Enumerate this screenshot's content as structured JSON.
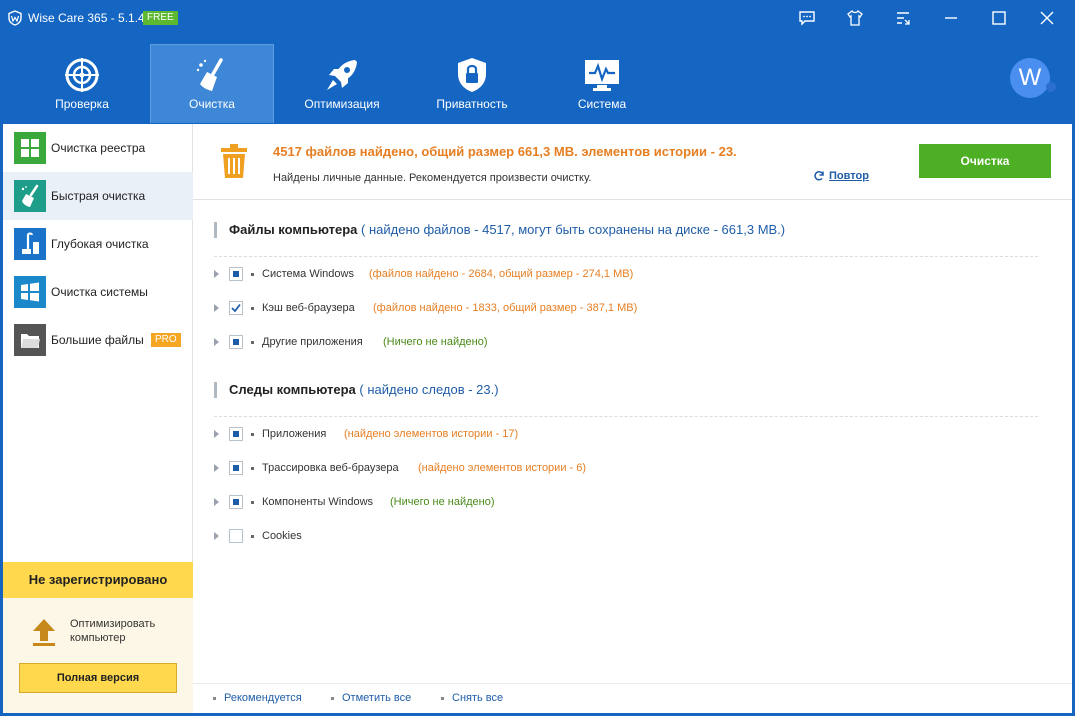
{
  "app": {
    "title": "Wise Care 365 - 5.1.4",
    "badge": "FREE",
    "avatar_letter": "W"
  },
  "window_controls": [
    "feedback-icon",
    "skin-icon",
    "menu-icon",
    "minimize-icon",
    "maximize-icon",
    "close-icon"
  ],
  "nav": {
    "items": [
      {
        "label": "Проверка",
        "icon": "radar-icon"
      },
      {
        "label": "Очистка",
        "icon": "broom-icon",
        "active": true
      },
      {
        "label": "Оптимизация",
        "icon": "rocket-icon"
      },
      {
        "label": "Приватность",
        "icon": "lock-shield-icon"
      },
      {
        "label": "Система",
        "icon": "monitor-icon"
      }
    ]
  },
  "sidebar": {
    "items": [
      {
        "label": "Очистка реестра",
        "icon": "grid-icon",
        "color": "#3aa83a"
      },
      {
        "label": "Быстрая очистка",
        "icon": "broom-icon",
        "color": "#1e9e8a",
        "active": true
      },
      {
        "label": "Глубокая очистка",
        "icon": "vacuum-icon",
        "color": "#1a73c9"
      },
      {
        "label": "Очистка системы",
        "icon": "windows-icon",
        "color": "#1a88c9"
      },
      {
        "label": "Большие файлы",
        "icon": "folder-icon",
        "color": "#555555",
        "badge": "PRO"
      }
    ],
    "register": {
      "heading": "Не зарегистрировано",
      "text": "Оптимизировать компьютер",
      "button": "Полная версия"
    }
  },
  "summary": {
    "title": "4517 файлов найдено, общий размер 661,3 MB. элементов истории - 23.",
    "subtitle": "Найдены личные данные. Рекомендуется произвести очистку.",
    "repeat_label": "Повтор",
    "clean_button": "Очистка"
  },
  "sections": [
    {
      "title": "Файлы компьютера",
      "info": "( найдено файлов - 4517, могут быть сохранены на диске - 661,3 MB.)",
      "rows": [
        {
          "name": "Система Windows",
          "detail": "(файлов найдено - 2684, общий размер - 274,1 MB)",
          "state": "partial",
          "detail_color": "orange"
        },
        {
          "name": "Кэш веб-браузера",
          "detail": "(файлов найдено - 1833, общий размер - 387,1 MB)",
          "state": "checked",
          "detail_color": "orange"
        },
        {
          "name": "Другие приложения",
          "detail": "(Ничего не найдено)",
          "state": "partial",
          "detail_color": "green"
        }
      ]
    },
    {
      "title": "Следы компьютера",
      "info": "( найдено следов - 23.)",
      "rows": [
        {
          "name": "Приложения",
          "detail": "(найдено элементов истории - 17)",
          "state": "partial",
          "detail_color": "orange"
        },
        {
          "name": "Трассировка веб-браузера",
          "detail": "(найдено элементов истории - 6)",
          "state": "partial",
          "detail_color": "orange"
        },
        {
          "name": "Компоненты Windows",
          "detail": "(Ничего не найдено)",
          "state": "partial",
          "detail_color": "green"
        },
        {
          "name": "Cookies",
          "detail": "",
          "state": "unchecked",
          "detail_color": "orange"
        }
      ]
    }
  ],
  "footer": {
    "links": [
      "Рекомендуется",
      "Отметить все",
      "Снять все"
    ]
  },
  "colors": {
    "brand_blue": "#1466c2",
    "clean_green": "#4caf24",
    "warning_orange": "#e67e22",
    "register_yellow": "#ffd84d"
  }
}
